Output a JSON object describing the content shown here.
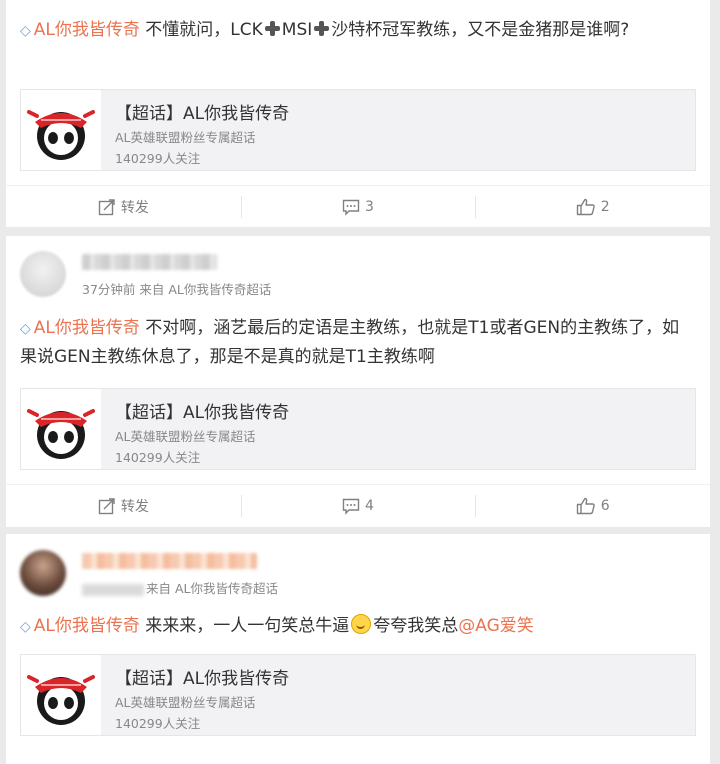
{
  "posts": [
    {
      "topic": "AL你我皆传奇",
      "text_parts": [
        "不懂就问，LCK",
        "MSI",
        "沙特杯冠军教练，又不是金猪那是谁啊?"
      ],
      "share": {
        "title": "【超话】AL你我皆传奇",
        "subtitle": "AL英雄联盟粉丝专属超话",
        "followers": "140299人关注"
      },
      "actions": {
        "repost": "转发",
        "comments": "3",
        "likes": "2"
      }
    },
    {
      "meta": "37分钟前 来自 AL你我皆传奇超话",
      "topic": "AL你我皆传奇",
      "text": "不对啊，涵艺最后的定语是主教练，也就是T1或者GEN的主教练了，如果说GEN主教练休息了，那是不是真的就是T1主教练啊",
      "share": {
        "title": "【超话】AL你我皆传奇",
        "subtitle": "AL英雄联盟粉丝专属超话",
        "followers": "140299人关注"
      },
      "actions": {
        "repost": "转发",
        "comments": "4",
        "likes": "6"
      }
    },
    {
      "meta": "来自 AL你我皆传奇超话",
      "topic": "AL你我皆传奇",
      "text_before": "来来来，一人一句笑总牛逼",
      "text_after": "夸夸我笑总",
      "mention": "@AG爱笑",
      "share": {
        "title": "【超话】AL你我皆传奇",
        "subtitle": "AL英雄联盟粉丝专属超话",
        "followers": "140299人关注"
      }
    }
  ],
  "icons": {
    "topic": "diamond-icon",
    "repost": "repost-icon",
    "comment": "comment-icon",
    "like": "thumbs-up-icon"
  },
  "colors": {
    "topic": "#eb7350",
    "background": "#eaeaea",
    "card": "#ffffff",
    "muted": "#808080"
  }
}
